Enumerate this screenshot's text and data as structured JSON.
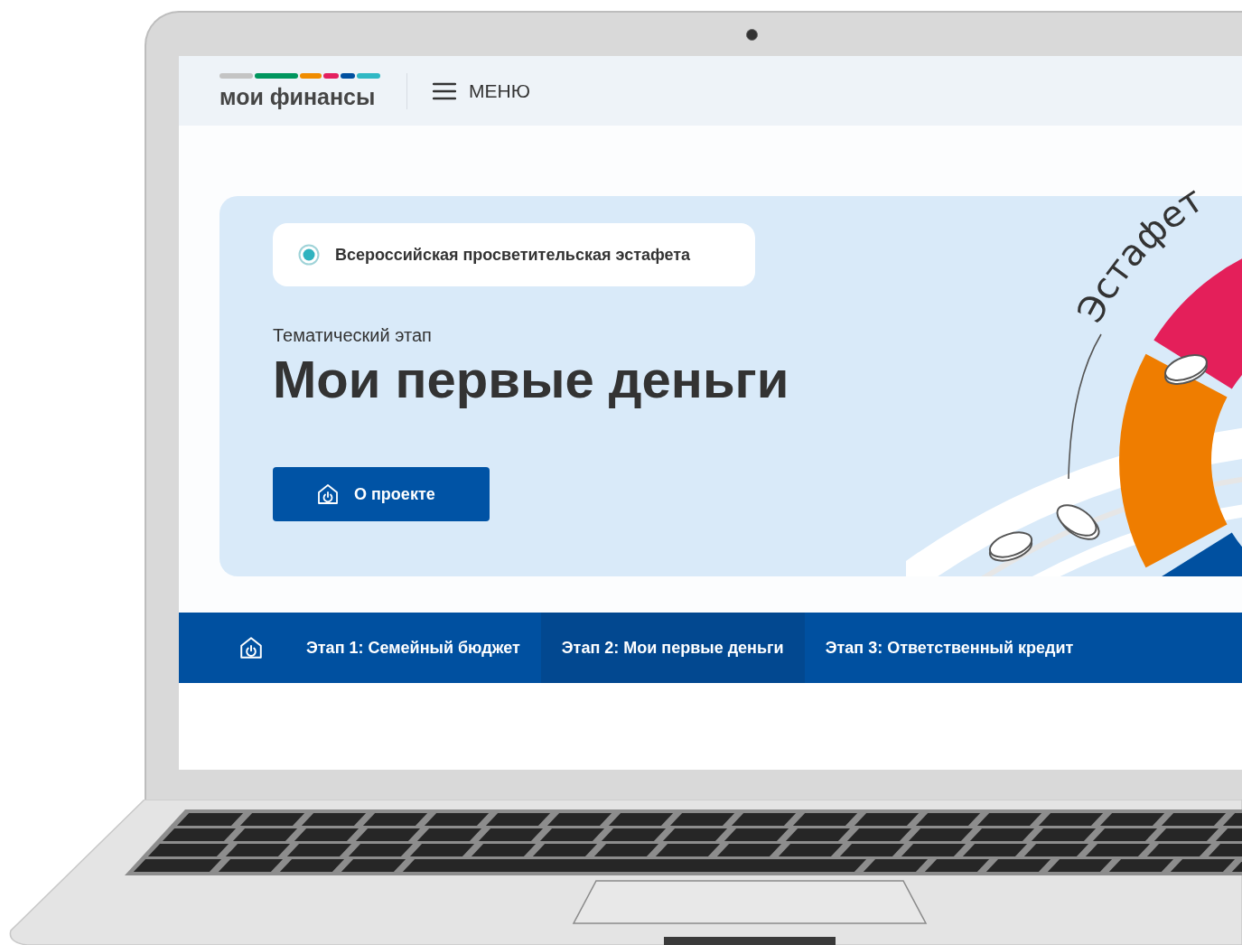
{
  "header": {
    "logo": {
      "text": "мои финансы",
      "stripes": [
        {
          "color": "#c4c4c4"
        },
        {
          "color": "#00965e"
        },
        {
          "color": "#f08c00"
        },
        {
          "color": "#e4205f"
        },
        {
          "color": "#0050a0"
        },
        {
          "color": "#30b8c4"
        }
      ]
    },
    "menu": {
      "label": "МЕНЮ"
    }
  },
  "hero": {
    "badge": {
      "text": "Всероссийская просветительская эстафета"
    },
    "subtitle": "Тематический этап",
    "title": "Мои первые деньги",
    "button": {
      "label": "О проекте"
    },
    "artwork": {
      "caption": "Эстафет"
    }
  },
  "nav": {
    "items": [
      {
        "label": "Этап 1: Семейный бюджет",
        "selected": false
      },
      {
        "label": "Этап 2: Мои первые деньги",
        "selected": true
      },
      {
        "label": "Этап 3: Ответственный кредит",
        "selected": false
      }
    ]
  }
}
